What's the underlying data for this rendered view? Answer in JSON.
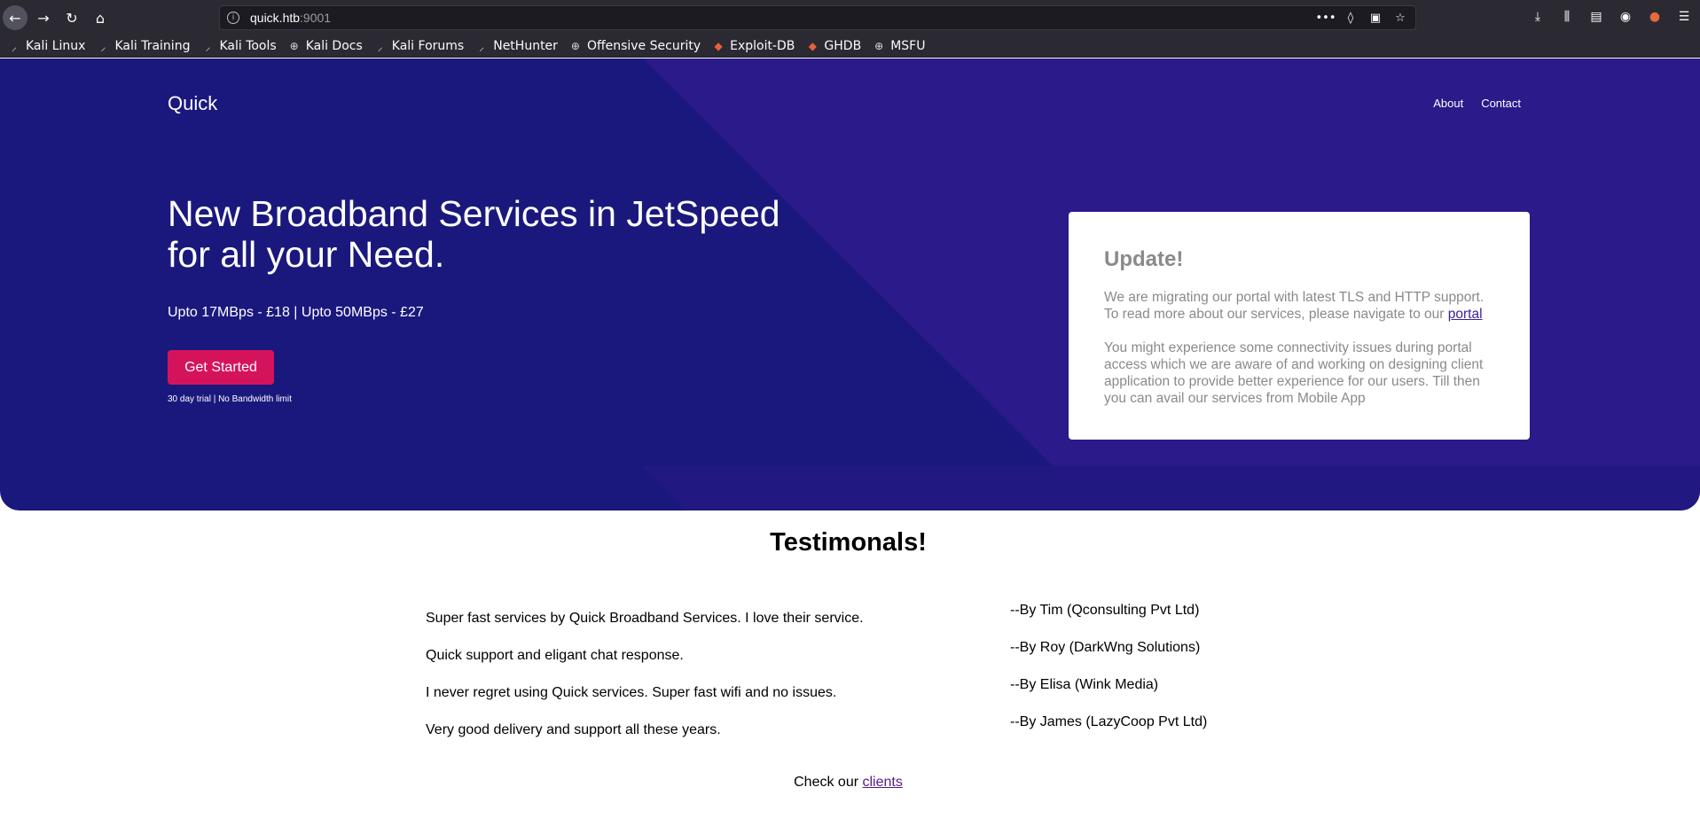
{
  "browser": {
    "url_host": "quick.htb",
    "url_port": ":9001",
    "bookmarks": [
      {
        "label": "Kali Linux",
        "icon": "kali-dragon-icon"
      },
      {
        "label": "Kali Training",
        "icon": "kali-dragon-icon"
      },
      {
        "label": "Kali Tools",
        "icon": "kali-dragon-icon"
      },
      {
        "label": "Kali Docs",
        "icon": "globe-icon"
      },
      {
        "label": "Kali Forums",
        "icon": "kali-dragon-icon"
      },
      {
        "label": "NetHunter",
        "icon": "kali-dragon-icon"
      },
      {
        "label": "Offensive Security",
        "icon": "globe-icon"
      },
      {
        "label": "Exploit-DB",
        "icon": "exploit-db-icon"
      },
      {
        "label": "GHDB",
        "icon": "exploit-db-icon"
      },
      {
        "label": "MSFU",
        "icon": "globe-icon"
      }
    ]
  },
  "site": {
    "brand": "Quick",
    "nav": {
      "about": "About",
      "contact": "Contact"
    },
    "hero": {
      "headline": "New Broadband Services in JetSpeed for all your Need.",
      "prices": "Upto 17MBps - £18 | Upto 50MBps - £27",
      "cta": "Get Started",
      "cta_note": "30 day trial | No Bandwidth limit"
    },
    "update": {
      "title": "Update!",
      "p1_text": "We are migrating our portal with latest TLS and HTTP support. To read more about our services, please navigate to our",
      "p1_link": "portal",
      "p2": "You might experience some connectivity issues during portal access which we are aware of and working on designing client application to provide better experience for our users. Till then you can avail our services from Mobile App"
    },
    "testimonials": {
      "title": "Testimonals!",
      "quotes": [
        "Super fast services by Quick Broadband Services. I love their service.",
        "Quick support and eligant chat response.",
        "I never regret using Quick services. Super fast wifi and no issues.",
        "Very good delivery and support all these years."
      ],
      "authors": [
        "--By Tim (Qconsulting Pvt Ltd)",
        "--By Roy (DarkWng Solutions)",
        "--By Elisa (Wink Media)",
        "--By James (LazyCoop Pvt Ltd)"
      ],
      "clients_text": "Check our",
      "clients_link": "clients"
    }
  },
  "colors": {
    "hero_bg": "#1b187d",
    "cta_bg": "#d5135d",
    "link": "#551a8b"
  }
}
